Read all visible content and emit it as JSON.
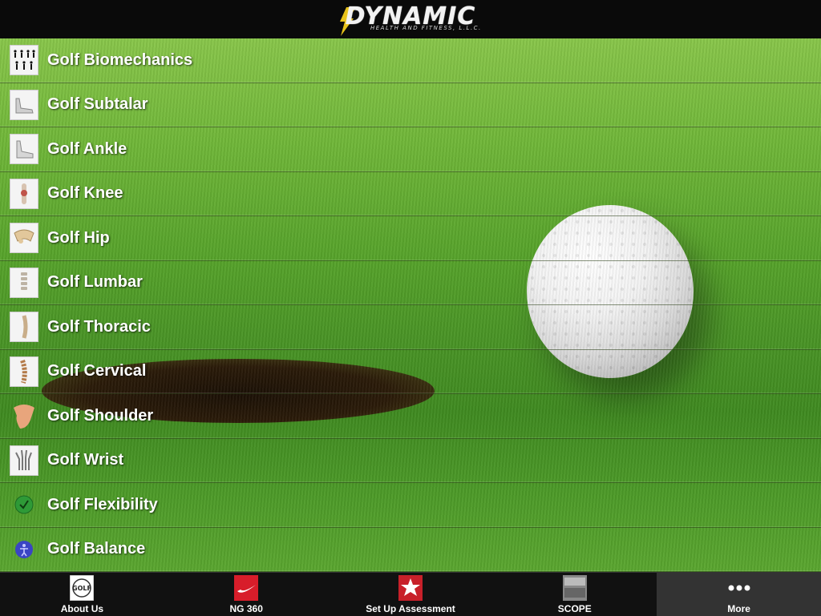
{
  "header": {
    "logo_word": "DYNAMIC",
    "logo_sub": "HEALTH AND FITNESS, L.L.C."
  },
  "menu": {
    "items": [
      {
        "label": "Golf Biomechanics",
        "icon": "golfer-silhouettes-icon"
      },
      {
        "label": "Golf Subtalar",
        "icon": "foot-xray-icon"
      },
      {
        "label": "Golf Ankle",
        "icon": "ankle-xray-icon"
      },
      {
        "label": "Golf Knee",
        "icon": "knee-anatomy-icon"
      },
      {
        "label": "Golf Hip",
        "icon": "hip-anatomy-icon"
      },
      {
        "label": "Golf Lumbar",
        "icon": "lumbar-spine-icon"
      },
      {
        "label": "Golf Thoracic",
        "icon": "thoracic-spine-icon"
      },
      {
        "label": "Golf Cervical",
        "icon": "cervical-spine-icon"
      },
      {
        "label": "Golf Shoulder",
        "icon": "shoulder-anatomy-icon"
      },
      {
        "label": "Golf Wrist",
        "icon": "wrist-xray-icon"
      },
      {
        "label": "Golf Flexibility",
        "icon": "green-check-icon"
      },
      {
        "label": "Golf Balance",
        "icon": "blue-figure-icon"
      }
    ]
  },
  "tabbar": {
    "tabs": [
      {
        "label": "About Us",
        "icon": "golf-logo-icon"
      },
      {
        "label": "NG 360",
        "icon": "nike-swoosh-icon"
      },
      {
        "label": "Set Up Assessment",
        "icon": "assessment-star-icon"
      },
      {
        "label": "SCOPE",
        "icon": "scope-icon"
      },
      {
        "label": "More",
        "icon": "more-dots-icon"
      }
    ]
  },
  "colors": {
    "header_bg": "#0a0a0a",
    "tabbar_bg": "#111111",
    "tab_active_bg": "#333333",
    "logo_bolt": "#e8c21a",
    "label_text": "#ffffff"
  }
}
